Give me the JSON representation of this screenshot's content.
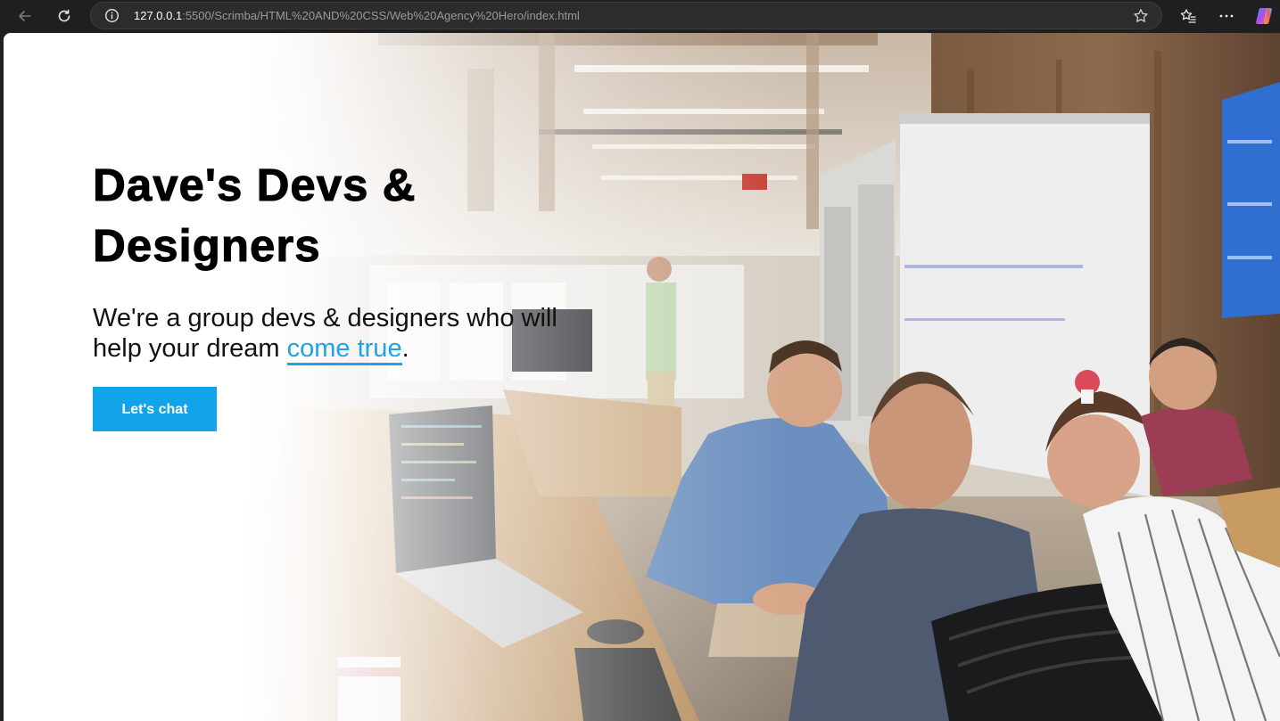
{
  "browser": {
    "url_host": "127.0.0.1",
    "url_path": ":5500/Scrimba/HTML%20AND%20CSS/Web%20Agency%20Hero/index.html"
  },
  "hero": {
    "title": "Dave's Devs & Designers",
    "text_before": "We're a group devs & designers who will help your dream ",
    "link_text": "come true",
    "text_after": ".",
    "button_label": "Let's chat"
  },
  "colors": {
    "accent": "#11a4ea",
    "link": "#1fa3e6",
    "chrome_bg": "#1f1f1f"
  },
  "icons": [
    "back-arrow-icon",
    "reload-icon",
    "info-icon",
    "star-icon",
    "favorites-icon",
    "more-menu-icon",
    "copilot-icon"
  ]
}
